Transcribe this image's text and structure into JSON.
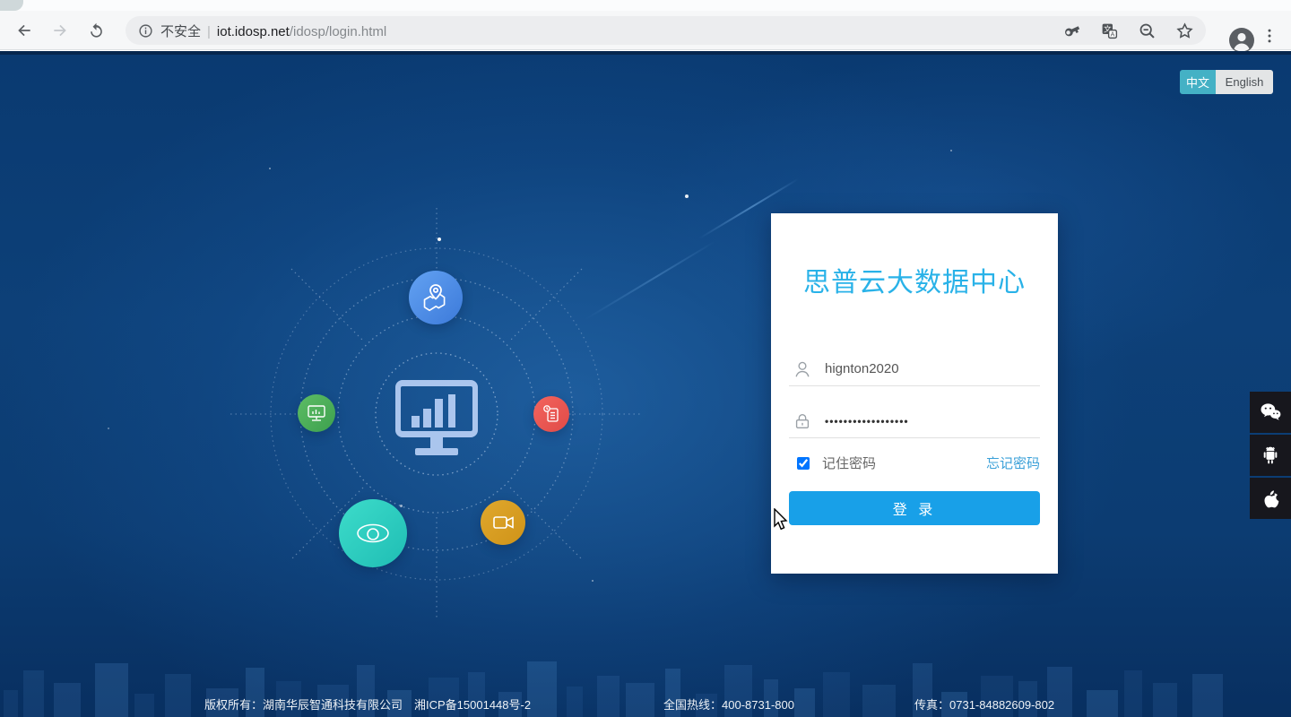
{
  "browser": {
    "security_label": "不安全",
    "separator": "|",
    "url_host": "iot.idosp.net",
    "url_path": "/idosp/login.html"
  },
  "language_toggle": {
    "chinese_label": "中文",
    "english_label": "English",
    "active": "chinese"
  },
  "login": {
    "title": "思普云大数据中心",
    "username_value": "hignton2020",
    "password_value": "••••••••••••••••••",
    "remember_label": "记住密码",
    "remember_checked": true,
    "forgot_label": "忘记密码",
    "submit_label": "登 录"
  },
  "footer": {
    "copyright": "版权所有：湖南华辰智通科技有限公司　湘ICP备15001448号-2",
    "hotline": "全国热线：400-8731-800",
    "fax": "传真：0731-84882609-802"
  },
  "colors": {
    "accent_blue": "#18a0e8",
    "title_cyan": "#29b2e8",
    "toggle_teal": "#44b1c5",
    "bg_navy": "#0d4078",
    "sat_blue": "#4a8de8",
    "sat_green": "#4aae59",
    "sat_red": "#ec5751",
    "sat_teal": "#2ed3c3",
    "sat_orange": "#d89d22"
  },
  "icons": [
    "back-icon",
    "forward-icon",
    "reload-icon",
    "info-icon",
    "key-icon",
    "translate-icon",
    "zoom-out-icon",
    "star-icon",
    "profile-icon",
    "menu-icon",
    "user-icon",
    "lock-icon",
    "map-pin-icon",
    "monitor-chart-icon",
    "report-icon",
    "eye-icon",
    "video-camera-icon",
    "wechat-icon",
    "android-icon",
    "apple-icon"
  ]
}
